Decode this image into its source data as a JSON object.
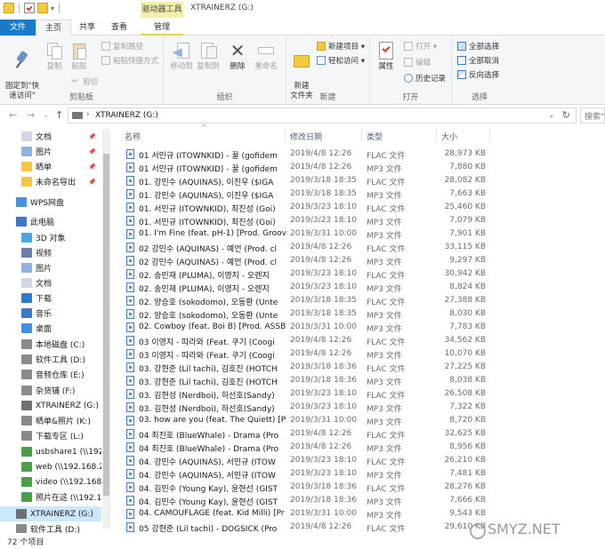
{
  "window": {
    "title": "XTRAINERZ (G:)",
    "context_tab": "驱动器工具"
  },
  "tabs": {
    "file": "文件",
    "home": "主页",
    "share": "共享",
    "view": "查看",
    "manage": "管理"
  },
  "ribbon": {
    "clipboard": {
      "label": "剪贴板",
      "pin": "固定到\"快\n速访问\"",
      "copy": "复制",
      "paste": "粘贴",
      "copy_path": "复制路径",
      "paste_shortcut": "粘贴快捷方式",
      "cut": "剪切"
    },
    "organize": {
      "label": "组织",
      "move_to": "移动到",
      "copy_to": "复制到",
      "delete": "删除",
      "rename": "重命名"
    },
    "new": {
      "label": "新建",
      "new_folder": "新建\n文件夹",
      "new_item": "新建项目 ▾",
      "easy_access": "轻松访问 ▾"
    },
    "open": {
      "label": "打开",
      "properties": "属性",
      "open": "打开 ▾",
      "edit": "编辑",
      "history": "历史记录"
    },
    "select": {
      "label": "选择",
      "select_all": "全部选择",
      "select_none": "全部取消",
      "invert": "反向选择"
    }
  },
  "address": {
    "path": "XTRAINERZ (G:)",
    "search_placeholder": "搜索\"XTRAINERZ (G:)\""
  },
  "nav": [
    {
      "label": "文档",
      "icon": "document-icon",
      "pinned": true
    },
    {
      "label": "图片",
      "icon": "pictures-icon",
      "pinned": true
    },
    {
      "label": "晒单",
      "icon": "folder-icon",
      "pinned": true
    },
    {
      "label": "未命名导出",
      "icon": "folder-icon",
      "pinned": true
    },
    {
      "label": "WPS网盘",
      "icon": "cloud-icon",
      "pinned": false
    },
    {
      "label": "此电脑",
      "icon": "computer-icon",
      "pinned": false
    },
    {
      "label": "3D 对象",
      "icon": "3d-objects-icon",
      "pinned": false
    },
    {
      "label": "视频",
      "icon": "video-icon",
      "pinned": false
    },
    {
      "label": "图片",
      "icon": "pictures-icon",
      "pinned": false
    },
    {
      "label": "文档",
      "icon": "document-icon",
      "pinned": false
    },
    {
      "label": "下载",
      "icon": "download-icon",
      "pinned": false
    },
    {
      "label": "音乐",
      "icon": "music-icon",
      "pinned": false
    },
    {
      "label": "桌面",
      "icon": "desktop-icon",
      "pinned": false
    },
    {
      "label": "本地磁盘 (C:)",
      "icon": "drive-icon",
      "pinned": false
    },
    {
      "label": "软件工具 (D:)",
      "icon": "drive-icon",
      "pinned": false
    },
    {
      "label": "音频仓库 (E:)",
      "icon": "drive-icon",
      "pinned": false
    },
    {
      "label": "杂货铺 (F:)",
      "icon": "drive-icon",
      "pinned": false
    },
    {
      "label": "XTRAINERZ (G:)",
      "icon": "usb-drive-icon",
      "pinned": false
    },
    {
      "label": "晒单&照片 (K:)",
      "icon": "drive-icon",
      "pinned": false
    },
    {
      "label": "下载专区 (L:)",
      "icon": "drive-icon",
      "pinned": false
    },
    {
      "label": "usbshare1 (\\\\192.",
      "icon": "network-drive-icon",
      "pinned": false
    },
    {
      "label": "web (\\\\192.168.2.1",
      "icon": "network-drive-icon",
      "pinned": false
    },
    {
      "label": "video (\\\\192.168.2",
      "icon": "network-drive-icon",
      "pinned": false
    },
    {
      "label": "照片在这 (\\\\192.16",
      "icon": "network-drive-icon",
      "pinned": false
    },
    {
      "label": "XTRAINERZ (G:)",
      "icon": "usb-drive-icon",
      "pinned": false,
      "selected": true
    },
    {
      "label": "软件工具 (D:)",
      "icon": "drive-icon",
      "pinned": false
    }
  ],
  "columns": {
    "name": "名称",
    "date": "修改日期",
    "type": "类型",
    "size": "大小"
  },
  "files": [
    {
      "name": "01 서민규 (ITOWNKID) - 꿀 (gofidem",
      "date": "2019/4/8 12:26",
      "type": "FLAC 文件",
      "size": "28,973 KB"
    },
    {
      "name": "01 서민규 (ITOWNKID) - 꿀 (gofidem",
      "date": "2019/4/8 12:26",
      "type": "MP3 文件",
      "size": "7,880 KB"
    },
    {
      "name": "01. 강민수 (AQUINAS), 이진우 ($IGA",
      "date": "2019/3/18 18:35",
      "type": "FLAC 文件",
      "size": "28,082 KB"
    },
    {
      "name": "01. 강민수 (AQUINAS), 이진우 ($IGA",
      "date": "2019/3/18 18:35",
      "type": "MP3 文件",
      "size": "7,663 KB"
    },
    {
      "name": "01. 서민규 (ITOWNKID), 최진성 (Goi)",
      "date": "2019/3/23 18:10",
      "type": "FLAC 文件",
      "size": "25,460 KB"
    },
    {
      "name": "01. 서민규 (ITOWNKID), 최진성 (Goi)",
      "date": "2019/3/23 18:10",
      "type": "MP3 文件",
      "size": "7,079 KB"
    },
    {
      "name": "01. I'm Fine (feat. pH-1) [Prod. Groov",
      "date": "2019/3/31 10:00",
      "type": "MP3 文件",
      "size": "7,901 KB"
    },
    {
      "name": "02 강민수 (AQUINAS) - 예언 (Prod. cl",
      "date": "2019/4/8 12:26",
      "type": "FLAC 文件",
      "size": "33,115 KB"
    },
    {
      "name": "02 강민수 (AQUINAS) - 예언 (Prod. cl",
      "date": "2019/4/8 12:26",
      "type": "MP3 文件",
      "size": "9,297 KB"
    },
    {
      "name": "02. 송민재 (PLUMA), 이영지 - 오렌지",
      "date": "2019/3/23 18:10",
      "type": "FLAC 文件",
      "size": "30,942 KB"
    },
    {
      "name": "02. 송민재 (PLUMA), 이영지 - 오렌지",
      "date": "2019/3/23 18:10",
      "type": "MP3 文件",
      "size": "8,824 KB"
    },
    {
      "name": "02. 양승호 (sokodomo), 오동환 (Unte",
      "date": "2019/3/18 18:35",
      "type": "FLAC 文件",
      "size": "27,388 KB"
    },
    {
      "name": "02. 양승호 (sokodomo), 오동환 (Unte",
      "date": "2019/3/18 18:35",
      "type": "MP3 文件",
      "size": "8,030 KB"
    },
    {
      "name": "02. Cowboy (feat. Boi B) [Prod. ASSB",
      "date": "2019/3/31 10:00",
      "type": "MP3 文件",
      "size": "7,783 KB"
    },
    {
      "name": "03 이영지 - 따라와 (Feat. 쿠기 (Coogi",
      "date": "2019/4/8 12:26",
      "type": "FLAC 文件",
      "size": "34,562 KB"
    },
    {
      "name": "03 이영지 - 따라와 (Feat. 쿠기 (Coogi",
      "date": "2019/4/8 12:26",
      "type": "MP3 文件",
      "size": "10,070 KB"
    },
    {
      "name": "03. 강현준 (Lil tachi), 김호진 (HOTCH",
      "date": "2019/3/18 18:36",
      "type": "FLAC 文件",
      "size": "27,225 KB"
    },
    {
      "name": "03. 강현준 (Lil tachi), 김호진 (HOTCH",
      "date": "2019/3/18 18:36",
      "type": "MP3 文件",
      "size": "8,038 KB"
    },
    {
      "name": "03. 김현성 (Nerdboi), 하선호(Sandy)",
      "date": "2019/3/23 18:10",
      "type": "FLAC 文件",
      "size": "26,508 KB"
    },
    {
      "name": "03. 김현성 (Nerdboi), 하선호(Sandy)",
      "date": "2019/3/23 18:10",
      "type": "MP3 文件",
      "size": "7,322 KB"
    },
    {
      "name": "03. how are you (feat. The Quiett) [Pr",
      "date": "2019/3/31 10:00",
      "type": "MP3 文件",
      "size": "8,720 KB"
    },
    {
      "name": "04 최진호 (BlueWhale) - Drama (Pro",
      "date": "2019/4/8 12:26",
      "type": "FLAC 文件",
      "size": "32,625 KB"
    },
    {
      "name": "04 최진호 (BlueWhale) - Drama (Pro",
      "date": "2019/4/8 12:26",
      "type": "MP3 文件",
      "size": "8,956 KB"
    },
    {
      "name": "04. 강민수 (AQUINAS), 서민규 (ITOW",
      "date": "2019/3/23 18:10",
      "type": "FLAC 文件",
      "size": "26,210 KB"
    },
    {
      "name": "04. 강민수 (AQUINAS), 서민규 (ITOW",
      "date": "2019/3/23 18:10",
      "type": "MP3 文件",
      "size": "7,481 KB"
    },
    {
      "name": "04. 김민수 (Young Kay), 윤현선 (GIST",
      "date": "2019/3/18 18:36",
      "type": "FLAC 文件",
      "size": "28,276 KB"
    },
    {
      "name": "04. 김민수 (Young Kay), 윤현선 (GIST",
      "date": "2019/3/18 18:36",
      "type": "MP3 文件",
      "size": "7,666 KB"
    },
    {
      "name": "04. CAMOUFLAGE (feat. Kid Milli) [Pr",
      "date": "2019/3/31 10:00",
      "type": "MP3 文件",
      "size": "9,543 KB"
    },
    {
      "name": "05 강현준 (Lil tachi) - DOGSICK (Pro",
      "date": "2019/4/8 12:26",
      "type": "FLAC 文件",
      "size": "29,610 KB"
    }
  ],
  "status": {
    "item_count": "72 个项目"
  },
  "watermark": "SMYZ.NET"
}
